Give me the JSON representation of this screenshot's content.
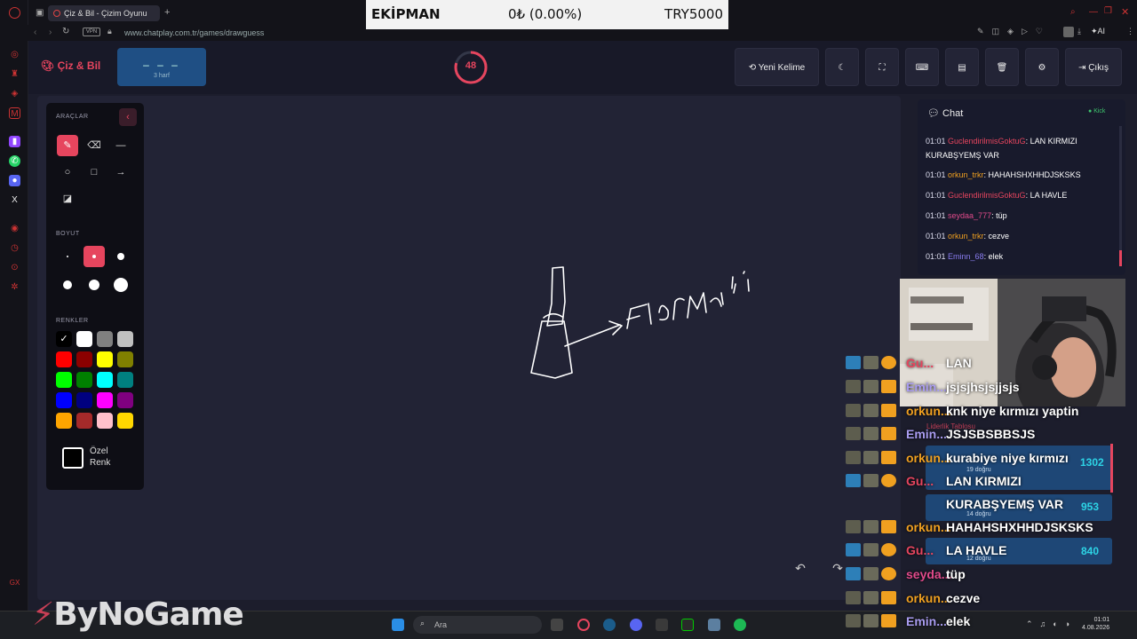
{
  "browser": {
    "tab_title": "Çiz & Bil - Çizim Oyunu",
    "url": "www.chatplay.com.tr/games/drawguess",
    "ai_label": "AI"
  },
  "banner": {
    "label": "EKİPMAN",
    "amount": "0₺ (0.00%)",
    "target": "TRY5000"
  },
  "app": {
    "logo": "Çiz & Bil",
    "word_mask": "– – –",
    "word_hint": "3 harf",
    "timer": "48",
    "buttons": {
      "new_word": "Yeni Kelime",
      "exit": "Çıkış"
    }
  },
  "tools": {
    "section_tools": "ARAÇLAR",
    "section_size": "BOYUT",
    "section_colors": "RENKLER",
    "custom_color": [
      "Özel",
      "Renk"
    ],
    "colors": [
      "#000000",
      "#ffffff",
      "#808080",
      "#c0c0c0",
      "#ff0000",
      "#8b0000",
      "#ffff00",
      "#808000",
      "#00ff00",
      "#008000",
      "#00ffff",
      "#008080",
      "#0000ff",
      "#000080",
      "#ff00ff",
      "#800080",
      "#ffa500",
      "#a52a2a",
      "#ffc0cb",
      "#ffd700"
    ]
  },
  "canvas": {
    "drawn_text": "Flormai"
  },
  "chat": {
    "title": "Chat",
    "status": "Kick",
    "messages": [
      {
        "time": "01:01",
        "user": "GuclendirilmisGoktuG",
        "user_color": "#e6455e",
        "text": "LAN KIRMIZI KURABŞYEMŞ VAR"
      },
      {
        "time": "01:01",
        "user": "orkun_trkr",
        "user_color": "#f0a020",
        "text": "HAHAHSHXHHDJSKSKS"
      },
      {
        "time": "01:01",
        "user": "GuclendirilmisGoktuG",
        "user_color": "#e6455e",
        "text": "LA HAVLE"
      },
      {
        "time": "01:01",
        "user": "seydaa_777",
        "user_color": "#e04a8a",
        "text": "tüp"
      },
      {
        "time": "01:01",
        "user": "orkun_trkr",
        "user_color": "#f0a020",
        "text": "cezve"
      },
      {
        "time": "01:01",
        "user": "Eminn_68",
        "user_color": "#8a7df0",
        "text": "elek"
      }
    ]
  },
  "overlay": [
    {
      "name": "Gu...",
      "color": "#e6455e",
      "text": "LAN"
    },
    {
      "name": "Emin...",
      "color": "#a99cf0",
      "text": "jsjsjhsjsjjsjs"
    },
    {
      "name": "orkun...",
      "color": "#f0a020",
      "text": "knk niye kırmızı yaptin"
    },
    {
      "name": "Emin...",
      "color": "#a99cf0",
      "text": "JSJSBSBBSJS"
    },
    {
      "name": "orkun...",
      "color": "#f0a020",
      "text": "kurabiye niye kırmızı"
    },
    {
      "name": "Gu...",
      "color": "#e6455e",
      "text": "LAN KIRMIZI"
    },
    {
      "name": "",
      "color": "#fff",
      "text": "KURABŞYEMŞ VAR"
    },
    {
      "name": "orkun...",
      "color": "#f0a020",
      "text": "HAHAHSHXHHDJSKSKS"
    },
    {
      "name": "Gu...",
      "color": "#e6455e",
      "text": "LA HAVLE"
    },
    {
      "name": "seyda...",
      "color": "#e04a8a",
      "text": "tüp"
    },
    {
      "name": "orkun...",
      "color": "#f0a020",
      "text": "cezve"
    },
    {
      "name": "Emin...",
      "color": "#a99cf0",
      "text": "elek"
    }
  ],
  "leaderboard": {
    "title": "Liderlik Tablosu",
    "scores": [
      "1302",
      "953",
      "840"
    ],
    "subs": [
      "19 doğru",
      "14 doğru",
      "12 doğru"
    ]
  },
  "taskbar": {
    "search": "Ara",
    "time": "01:01",
    "date": "4.08.2026",
    "brand": "ByNoGame"
  }
}
